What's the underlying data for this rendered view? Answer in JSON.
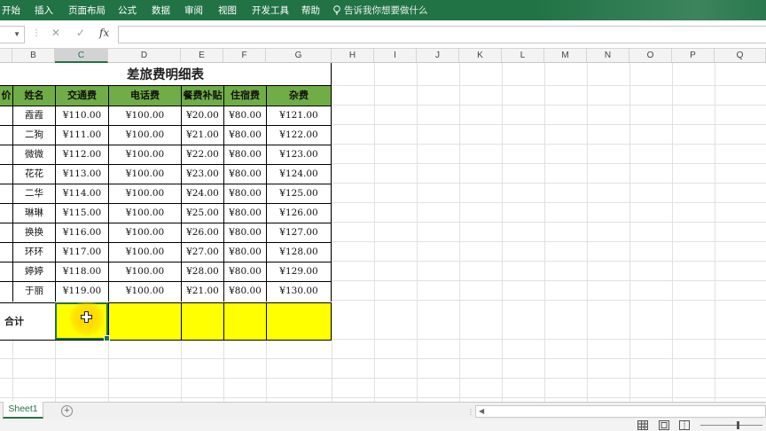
{
  "ribbon": {
    "tabs": [
      "开始",
      "插入",
      "页面布局",
      "公式",
      "数据",
      "审阅",
      "视图",
      "开发工具",
      "帮助"
    ],
    "tell_me": "告诉我你想要做什么"
  },
  "formula_bar": {
    "fx_label": "fx",
    "cancel_glyph": "✕",
    "enter_glyph": "✓"
  },
  "columns": [
    "B",
    "C",
    "D",
    "E",
    "F",
    "G",
    "H",
    "I",
    "J",
    "K",
    "L",
    "M",
    "N",
    "O",
    "P",
    "Q"
  ],
  "selected_column": "C",
  "table": {
    "title": "差旅费明细表",
    "headers": {
      "a": "价",
      "b": "姓名",
      "c": "交通费",
      "d": "电话费",
      "e": "餐费补贴",
      "f": "住宿费",
      "g": "杂费"
    },
    "rows": [
      {
        "name": "霞霞",
        "transport": "¥110.00",
        "phone": "¥100.00",
        "meal": "¥20.00",
        "lodging": "¥80.00",
        "misc": "¥121.00"
      },
      {
        "name": "二狗",
        "transport": "¥111.00",
        "phone": "¥100.00",
        "meal": "¥21.00",
        "lodging": "¥80.00",
        "misc": "¥122.00"
      },
      {
        "name": "微微",
        "transport": "¥112.00",
        "phone": "¥100.00",
        "meal": "¥22.00",
        "lodging": "¥80.00",
        "misc": "¥123.00"
      },
      {
        "name": "花花",
        "transport": "¥113.00",
        "phone": "¥100.00",
        "meal": "¥23.00",
        "lodging": "¥80.00",
        "misc": "¥124.00"
      },
      {
        "name": "二华",
        "transport": "¥114.00",
        "phone": "¥100.00",
        "meal": "¥24.00",
        "lodging": "¥80.00",
        "misc": "¥125.00"
      },
      {
        "name": "琳琳",
        "transport": "¥115.00",
        "phone": "¥100.00",
        "meal": "¥25.00",
        "lodging": "¥80.00",
        "misc": "¥126.00"
      },
      {
        "name": "换换",
        "transport": "¥116.00",
        "phone": "¥100.00",
        "meal": "¥26.00",
        "lodging": "¥80.00",
        "misc": "¥127.00"
      },
      {
        "name": "环环",
        "transport": "¥117.00",
        "phone": "¥100.00",
        "meal": "¥27.00",
        "lodging": "¥80.00",
        "misc": "¥128.00"
      },
      {
        "name": "婷婷",
        "transport": "¥118.00",
        "phone": "¥100.00",
        "meal": "¥28.00",
        "lodging": "¥80.00",
        "misc": "¥129.00"
      },
      {
        "name": "于丽",
        "transport": "¥119.00",
        "phone": "¥100.00",
        "meal": "¥21.00",
        "lodging": "¥80.00",
        "misc": "¥130.00"
      }
    ],
    "total_label": "合计"
  },
  "sheets": [
    "Sheet1"
  ],
  "colors": {
    "ribbon": "#217346",
    "header_fill": "#70ad47",
    "total_fill": "#ffff00"
  }
}
